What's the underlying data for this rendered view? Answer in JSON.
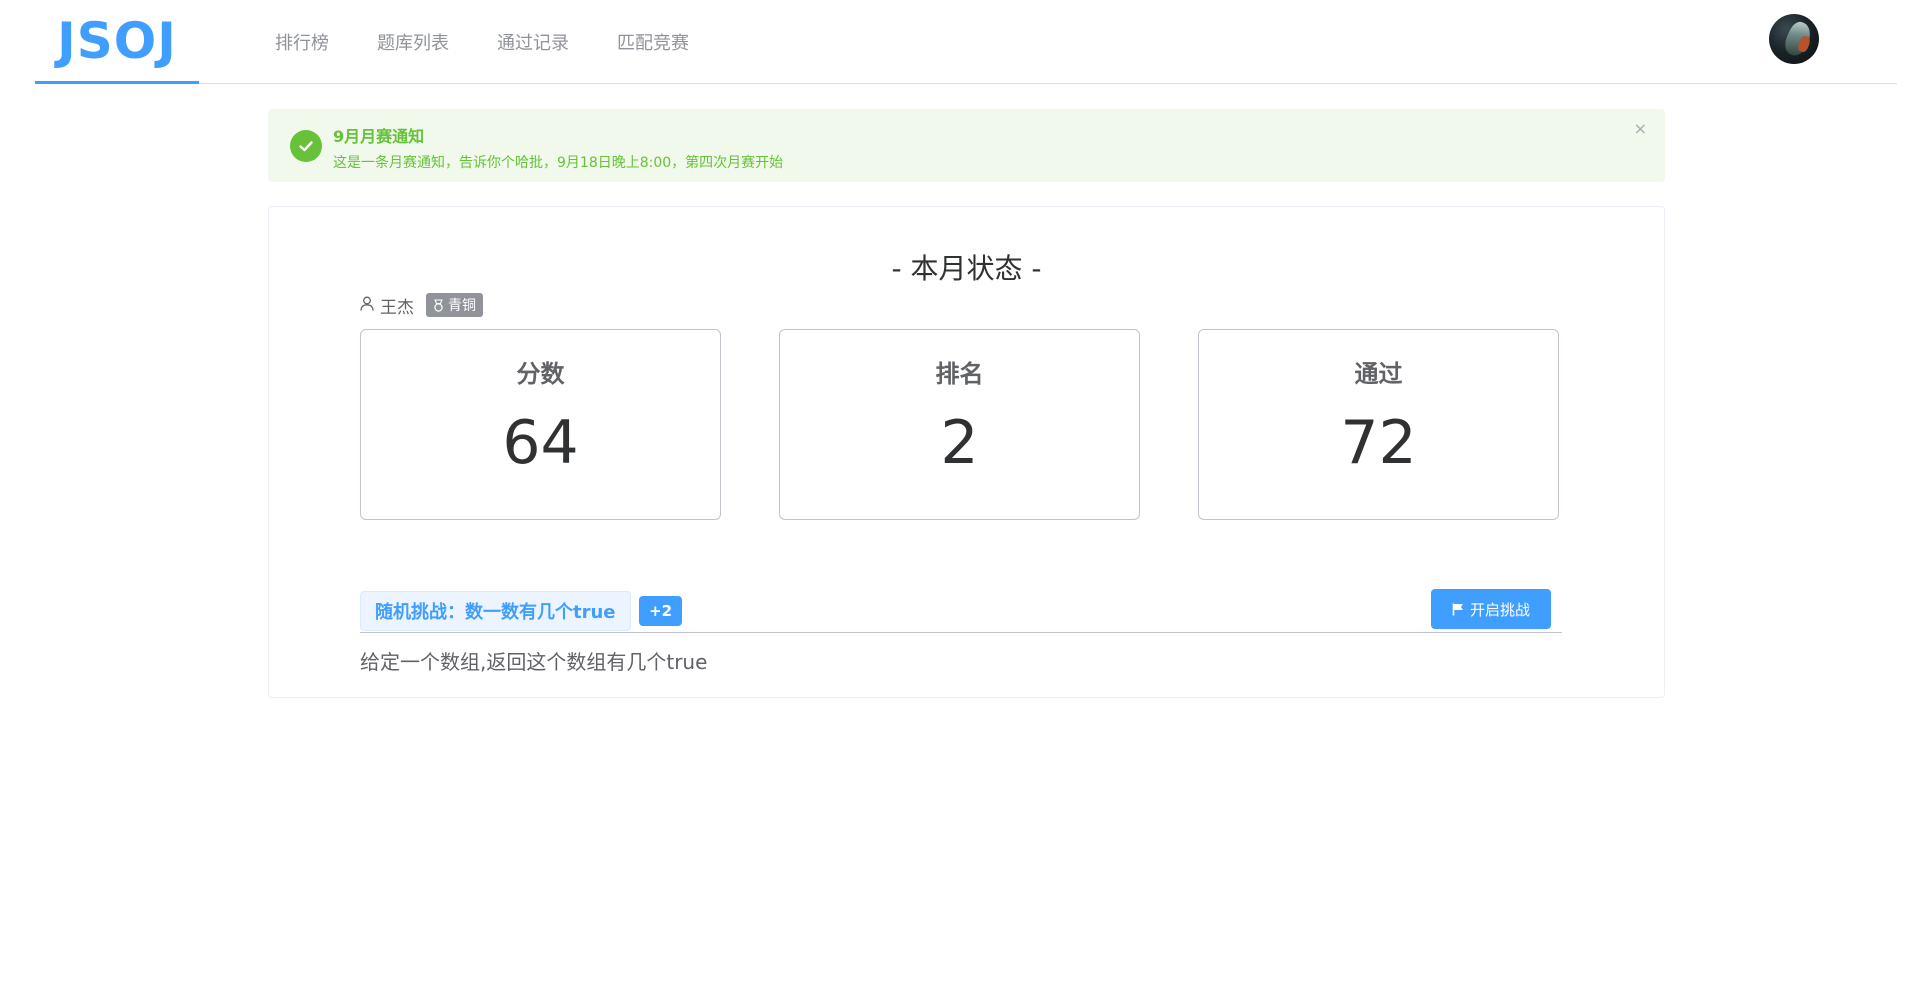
{
  "header": {
    "logo": "JSOJ",
    "nav": [
      "排行榜",
      "题库列表",
      "通过记录",
      "匹配竞赛"
    ]
  },
  "alert": {
    "title": "9月月赛通知",
    "description": "这是一条月赛通知，告诉你个哈批，9月18日晚上8:00，第四次月赛开始",
    "close": "×",
    "type": "success"
  },
  "status": {
    "title": "- 本月状态 -",
    "user": {
      "name": "王杰",
      "rank": "青铜"
    },
    "stats": [
      {
        "label": "分数",
        "value": "64"
      },
      {
        "label": "排名",
        "value": "2"
      },
      {
        "label": "通过",
        "value": "72"
      }
    ]
  },
  "challenge": {
    "tag": "随机挑战：数一数有几个true",
    "badge": "+2",
    "button": "开启挑战",
    "description": "给定一个数组,返回这个数组有几个true"
  },
  "colors": {
    "primary": "#409eff",
    "success": "#67c23a",
    "success_bg": "#f0f9eb",
    "rank_tag": "#909399"
  }
}
